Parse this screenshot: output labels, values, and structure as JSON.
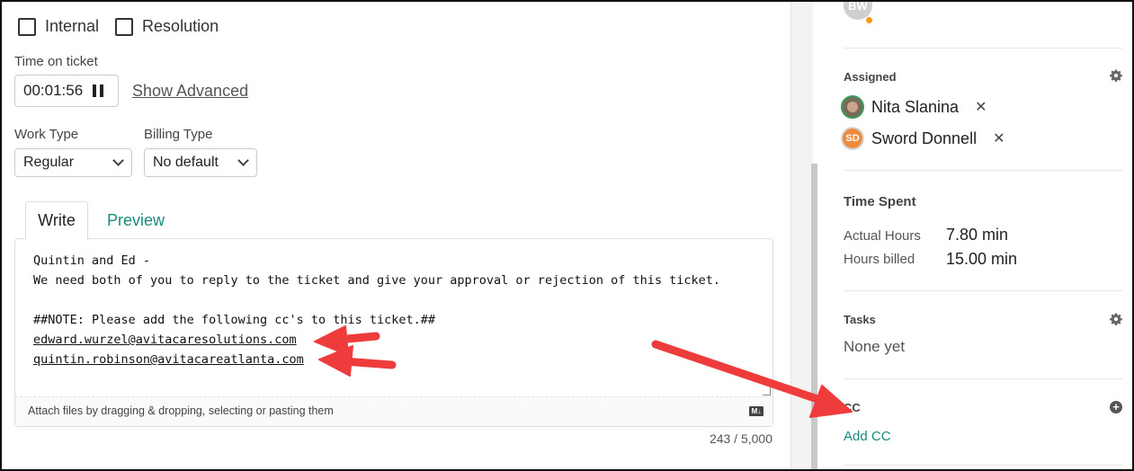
{
  "checkboxes": {
    "internal": "Internal",
    "resolution": "Resolution"
  },
  "time": {
    "label": "Time on ticket",
    "value": "00:01:56",
    "advanced": "Show Advanced"
  },
  "work_type": {
    "label": "Work Type",
    "value": "Regular"
  },
  "billing_type": {
    "label": "Billing Type",
    "value": "No default"
  },
  "editor": {
    "tab_write": "Write",
    "tab_preview": "Preview",
    "line1": "Quintin and Ed -",
    "line2": "We need both of you to reply to the ticket and give your approval or rejection of this ticket.",
    "line3": "##NOTE: Please add the following cc's to this ticket.##",
    "email1": "edward.wurzel@avitacaresolutions.com",
    "email2": "quintin.robinson@avitacareatlanta.com",
    "attach_hint": "Attach files by dragging & dropping, selecting or pasting them",
    "markdown_badge": "M↓",
    "char_count": "243 / 5,000"
  },
  "sidebar": {
    "top_avatar_initials": "BW",
    "assigned": {
      "title": "Assigned",
      "people": [
        {
          "name": "Nita Slanina",
          "initials": ""
        },
        {
          "name": "Sword Donnell",
          "initials": "SD"
        }
      ]
    },
    "time_spent": {
      "title": "Time Spent",
      "actual_label": "Actual Hours",
      "actual_value": "7.80 min",
      "billed_label": "Hours billed",
      "billed_value": "15.00 min"
    },
    "tasks": {
      "title": "Tasks",
      "empty": "None yet"
    },
    "cc": {
      "title": "CC",
      "add": "Add CC"
    }
  },
  "colors": {
    "accent": "#1a8a7a",
    "annotation_arrow": "#ee3b3b",
    "status_dot": "#f29a1a"
  },
  "icons": [
    "checkbox-icon",
    "pause-icon",
    "chevron-down-icon",
    "markdown-icon",
    "gear-icon",
    "close-icon",
    "plus-circle-icon"
  ]
}
